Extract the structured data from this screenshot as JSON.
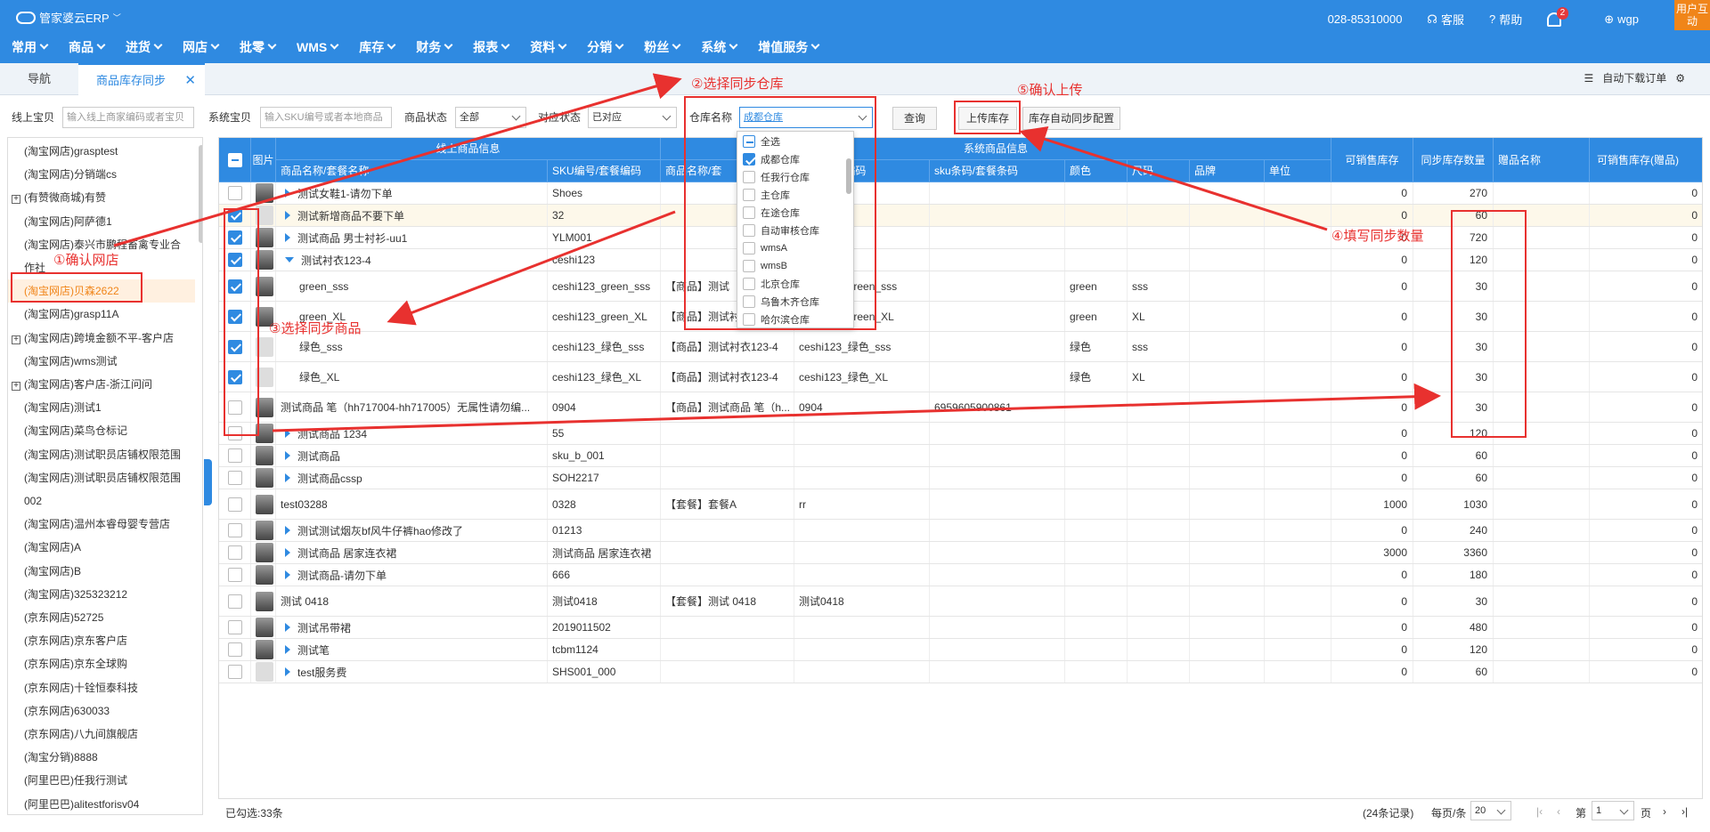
{
  "app": {
    "logo_text": "管家婆云ERP",
    "phone": "028-85310000",
    "service": "客服",
    "help": "帮助",
    "bell_count": "2",
    "user": "wgp",
    "user_btn": "用户互动"
  },
  "menu": [
    "常用",
    "商品",
    "进货",
    "网店",
    "批零",
    "WMS",
    "库存",
    "财务",
    "报表",
    "资料",
    "分销",
    "粉丝",
    "系统",
    "增值服务"
  ],
  "tabs": {
    "nav": "导航",
    "active": "商品库存同步",
    "close": "✕",
    "auto": "自动下载订单"
  },
  "filters": {
    "online_label": "线上宝贝",
    "online_ph": "输入线上商家编码或者宝贝",
    "system_label": "系统宝贝",
    "system_ph": "输入SKU编号或者本地商品",
    "status_label": "商品状态",
    "status_val": "全部",
    "match_label": "对应状态",
    "match_val": "已对应",
    "wh_label": "仓库名称",
    "wh_val": "成都仓库",
    "query": "查询",
    "upload": "上传库存",
    "autocfg": "库存自动同步配置"
  },
  "warehouses": [
    "全选",
    "成都仓库",
    "任我行仓库",
    "主仓库",
    "在途仓库",
    "自动审核仓库",
    "wmsA",
    "wmsB",
    "北京仓库",
    "乌鲁木齐仓库",
    "哈尔滨仓库"
  ],
  "shops": [
    "(淘宝网店)grasptest",
    "(淘宝网店)分销端cs",
    "(有赞微商城)有赞",
    "(淘宝网店)阿萨德1",
    "(淘宝网店)泰兴市鹏程畜禽专业合",
    "作社",
    "(淘宝网店)贝森2622",
    "(淘宝网店)grasp11A",
    "(淘宝网店)跨境金额不平-客户店",
    "(淘宝网店)wms测试",
    "(淘宝网店)客户店-浙江问问",
    "(淘宝网店)测试1",
    "(淘宝网店)菜鸟仓标记",
    "(淘宝网店)测试职员店铺权限范围",
    "(淘宝网店)测试职员店铺权限范围",
    "002",
    "(淘宝网店)温州本睿母婴专营店",
    "(淘宝网店)A",
    "(淘宝网店)B",
    "(淘宝网店)325323212",
    "(京东网店)52725",
    "(京东网店)京东客户店",
    "(京东网店)京东全球购",
    "(京东网店)十铨恒泰科技",
    "(京东网店)630033",
    "(京东网店)八九间旗舰店",
    "(淘宝分销)8888",
    "(阿里巴巴)任我行测试",
    "(阿里巴巴)alitestforisv04"
  ],
  "headers": {
    "pic": "图片",
    "online": "线上商品信息",
    "system": "系统商品信息",
    "name": "商品名称/套餐名称",
    "sku": "SKU编号/套餐编码",
    "sname": "商品名称/套",
    "scode": "编号/套餐编码",
    "barcode": "sku条码/套餐条码",
    "color": "颜色",
    "size": "尺码",
    "brand": "品牌",
    "unit": "单位",
    "sellable": "可销售库存",
    "sync": "同步库存数量",
    "gift": "赠品名称",
    "giftsell": "可销售库存(赠品)"
  },
  "rows": [
    {
      "name": "测试女鞋1-请勿下单",
      "sku": "Shoes",
      "sname": "",
      "scode": "",
      "bar": "",
      "color": "",
      "size": "",
      "sell": "0",
      "sync": "270",
      "g": "0"
    },
    {
      "name": "测试新增商品不要下单",
      "sku": "32",
      "sname": "",
      "scode": "",
      "bar": "",
      "color": "",
      "size": "",
      "sell": "0",
      "sync": "60",
      "g": "0"
    },
    {
      "name": "测试商品 男士衬衫-uu1",
      "sku": "YLM001",
      "sname": "",
      "scode": "",
      "bar": "",
      "color": "",
      "size": "",
      "sell": "0",
      "sync": "720",
      "g": "0"
    },
    {
      "name": "测试衬衣123-4",
      "sku": "ceshi123",
      "sname": "",
      "scode": "",
      "bar": "",
      "color": "",
      "size": "",
      "sell": "0",
      "sync": "120",
      "g": "0"
    },
    {
      "name": "green_sss",
      "sku": "ceshi123_green_sss",
      "sname": "【商品】测试",
      "scode": "ceshi123_green_sss",
      "bar": "",
      "color": "green",
      "size": "sss",
      "sell": "0",
      "sync": "30",
      "g": "0"
    },
    {
      "name": "green_XL",
      "sku": "ceshi123_green_XL",
      "sname": "【商品】测试衬衣123-4",
      "scode": "ceshi123_green_XL",
      "bar": "",
      "color": "green",
      "size": "XL",
      "sell": "0",
      "sync": "30",
      "g": "0"
    },
    {
      "name": "绿色_sss",
      "sku": "ceshi123_绿色_sss",
      "sname": "【商品】测试衬衣123-4",
      "scode": "ceshi123_绿色_sss",
      "bar": "",
      "color": "绿色",
      "size": "sss",
      "sell": "0",
      "sync": "30",
      "g": "0"
    },
    {
      "name": "绿色_XL",
      "sku": "ceshi123_绿色_XL",
      "sname": "【商品】测试衬衣123-4",
      "scode": "ceshi123_绿色_XL",
      "bar": "",
      "color": "绿色",
      "size": "XL",
      "sell": "0",
      "sync": "30",
      "g": "0"
    },
    {
      "name": "测试商品 笔（hh717004-hh717005）无属性请勿编...",
      "sku": "0904",
      "sname": "【商品】测试商品 笔（h...",
      "scode": "0904",
      "bar": "6959605900861",
      "color": "",
      "size": "",
      "sell": "0",
      "sync": "30",
      "g": "0"
    },
    {
      "name": "测试商品 1234",
      "sku": "55",
      "sname": "",
      "scode": "",
      "bar": "",
      "color": "",
      "size": "",
      "sell": "0",
      "sync": "120",
      "g": "0"
    },
    {
      "name": "测试商品",
      "sku": "sku_b_001",
      "sname": "",
      "scode": "",
      "bar": "",
      "color": "",
      "size": "",
      "sell": "0",
      "sync": "60",
      "g": "0"
    },
    {
      "name": "测试商品cssp",
      "sku": "SOH2217",
      "sname": "",
      "scode": "",
      "bar": "",
      "color": "",
      "size": "",
      "sell": "0",
      "sync": "60",
      "g": "0"
    },
    {
      "name": "test03288",
      "sku": "0328",
      "sname": "【套餐】套餐A",
      "scode": "rr",
      "bar": "",
      "color": "",
      "size": "",
      "sell": "1000",
      "sync": "1030",
      "g": "0"
    },
    {
      "name": "测试测试烟灰bf风牛仔裤hao修改了",
      "sku": "01213",
      "sname": "",
      "scode": "",
      "bar": "",
      "color": "",
      "size": "",
      "sell": "0",
      "sync": "240",
      "g": "0"
    },
    {
      "name": "测试商品 居家连衣裙",
      "sku": "测试商品 居家连衣裙",
      "sname": "",
      "scode": "",
      "bar": "",
      "color": "",
      "size": "",
      "sell": "3000",
      "sync": "3360",
      "g": "0"
    },
    {
      "name": "测试商品-请勿下单",
      "sku": "666",
      "sname": "",
      "scode": "",
      "bar": "",
      "color": "",
      "size": "",
      "sell": "0",
      "sync": "180",
      "g": "0"
    },
    {
      "name": "测试 0418",
      "sku": "测试0418",
      "sname": "【套餐】测试 0418",
      "scode": "测试0418",
      "bar": "",
      "color": "",
      "size": "",
      "sell": "0",
      "sync": "30",
      "g": "0"
    },
    {
      "name": "测试吊带裙",
      "sku": "2019011502",
      "sname": "",
      "scode": "",
      "bar": "",
      "color": "",
      "size": "",
      "sell": "0",
      "sync": "480",
      "g": "0"
    },
    {
      "name": "测试笔",
      "sku": "tcbm1124",
      "sname": "",
      "scode": "",
      "bar": "",
      "color": "",
      "size": "",
      "sell": "0",
      "sync": "120",
      "g": "0"
    },
    {
      "name": "test服务费",
      "sku": "SHS001_000",
      "sname": "",
      "scode": "",
      "bar": "",
      "color": "",
      "size": "",
      "sell": "0",
      "sync": "60",
      "g": "0"
    }
  ],
  "footer": {
    "selected": "已勾选:33条",
    "records": "(24条记录)",
    "perpage_label": "每页/条",
    "perpage": "20",
    "page_label": "第",
    "page": "1",
    "page_unit": "页"
  },
  "annotations": {
    "a1": "①确认网店",
    "a2": "②选择同步仓库",
    "a3": "③选择同步商品",
    "a4": "④填写同步数量",
    "a5": "⑤确认上传"
  },
  "colors": {
    "topbar": "#2f8ae1",
    "accent_orange": "#f08519",
    "annotation_red": "#e8312f"
  }
}
